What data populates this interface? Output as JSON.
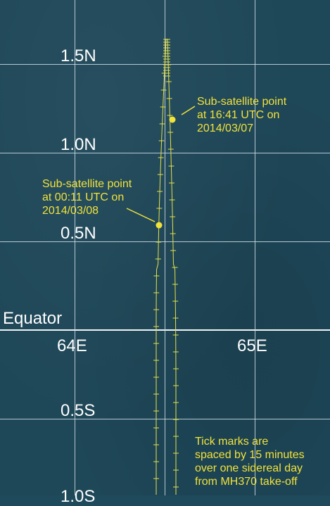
{
  "map": {
    "latitude_labels": [
      "1.5N",
      "1.0N",
      "0.5N",
      "0.5S",
      "1.0S"
    ],
    "longitude_labels": [
      "64E",
      "65E"
    ],
    "equator_label": "Equator"
  },
  "annotations": {
    "point1": {
      "label": [
        "Sub-satellite point",
        "at 16:41 UTC on",
        "2014/03/07"
      ],
      "lat": 1.14
    },
    "point2": {
      "label": [
        "Sub-satellite point",
        "at 00:11 UTC on",
        "2014/03/08"
      ],
      "lat": 0.55
    },
    "note": [
      "Tick marks are",
      "spaced by 15 minutes",
      "over one sidereal day",
      "from MH370 take-off"
    ]
  },
  "colors": {
    "track": "#e6e04a",
    "annotation": "#f2e23a",
    "grid": "#d2e1e8",
    "background": "#1e4758"
  }
}
